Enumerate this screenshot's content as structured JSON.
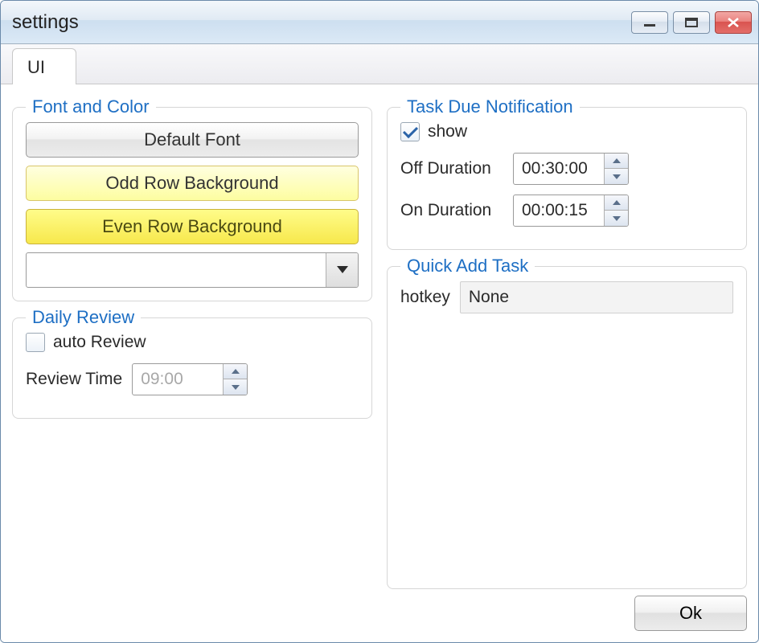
{
  "window_title": "settings",
  "tabs": [
    {
      "label": "UI"
    }
  ],
  "font_color": {
    "title": "Font and Color",
    "default_font_label": "Default Font",
    "odd_row_bg_label": "Odd Row Background",
    "even_row_bg_label": "Even Row Background",
    "combo_value": ""
  },
  "daily_review": {
    "title": "Daily Review",
    "auto_review_label": "auto Review",
    "auto_review_checked": false,
    "review_time_label": "Review Time",
    "review_time_value": "09:00"
  },
  "task_due": {
    "title": "Task Due Notification",
    "show_label": "show",
    "show_checked": true,
    "off_duration_label": "Off Duration",
    "off_duration_value": "00:30:00",
    "on_duration_label": "On Duration",
    "on_duration_value": "00:00:15"
  },
  "quick_add": {
    "title": "Quick Add Task",
    "hotkey_label": "hotkey",
    "hotkey_value": "None"
  },
  "ok_label": "Ok"
}
